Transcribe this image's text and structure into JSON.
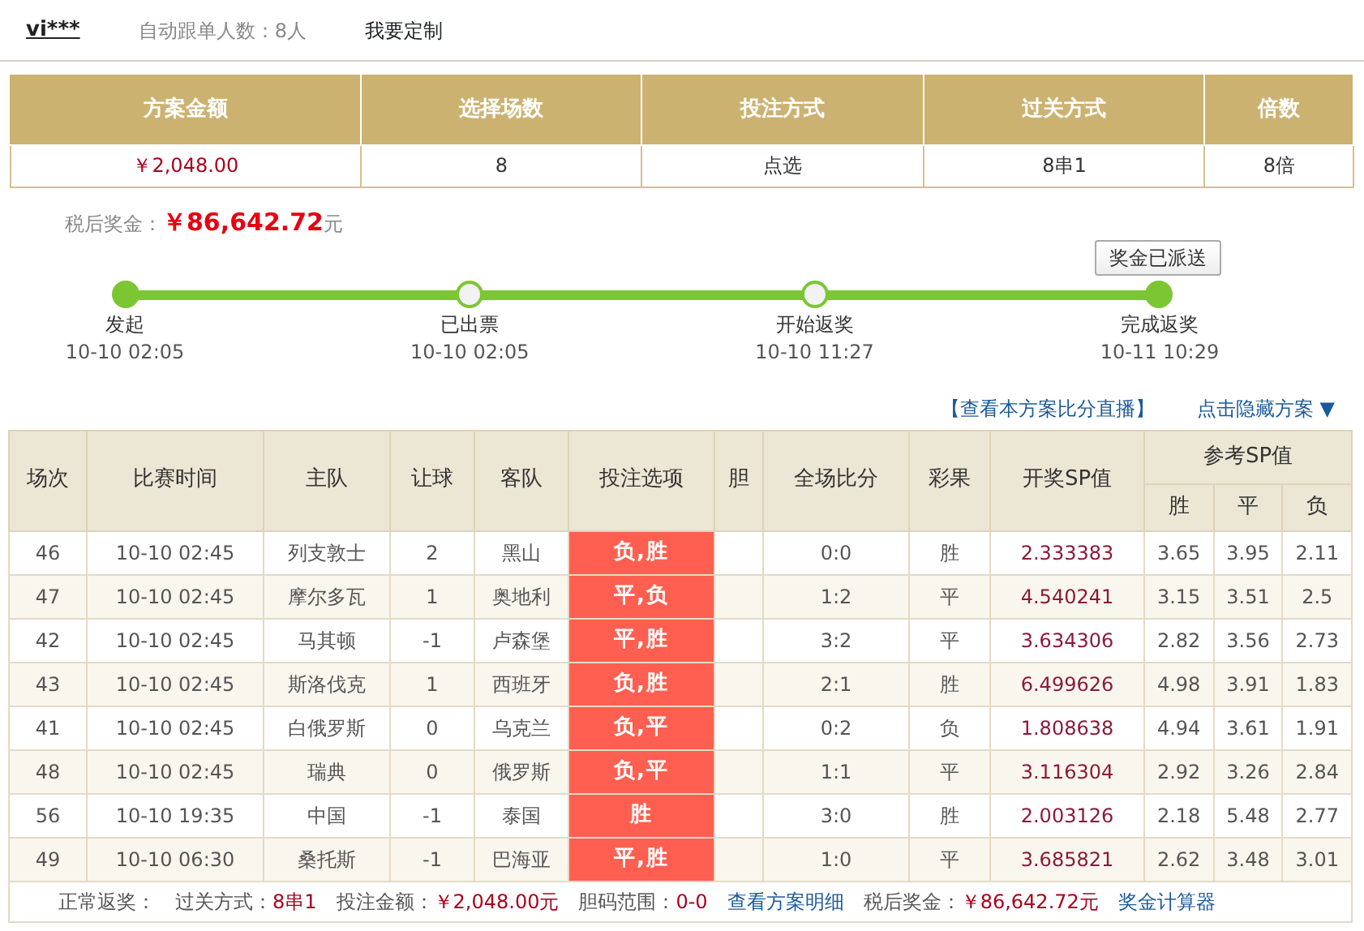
{
  "header": {
    "user": "vi***",
    "followers_label": "自动跟单人数：",
    "followers": "8人",
    "customize": "我要定制"
  },
  "summary": {
    "columns": [
      "方案金额",
      "选择场数",
      "投注方式",
      "过关方式",
      "倍数"
    ],
    "values": [
      "￥2,048.00",
      "8",
      "点选",
      "8串1",
      "8倍"
    ]
  },
  "prize": {
    "label": "税后奖金：",
    "amount": "￥86,642.72",
    "unit": "元"
  },
  "status_button": "奖金已派送",
  "timeline": [
    {
      "label": "发起",
      "time": "10-10 02:05",
      "filled": true
    },
    {
      "label": "已出票",
      "time": "10-10 02:05",
      "filled": false
    },
    {
      "label": "开始返奖",
      "time": "10-10 11:27",
      "filled": false
    },
    {
      "label": "完成返奖",
      "time": "10-11 10:29",
      "filled": true
    }
  ],
  "links": {
    "live": "【查看本方案比分直播】",
    "hide": "点击隐藏方案 ▼"
  },
  "table": {
    "columns": [
      "场次",
      "比赛时间",
      "主队",
      "让球",
      "客队",
      "投注选项",
      "胆",
      "全场比分",
      "彩果",
      "开奖SP值"
    ],
    "ref_group": "参考SP值",
    "ref_columns": [
      "胜",
      "平",
      "负"
    ],
    "rows": [
      {
        "no": "46",
        "time": "10-10 02:45",
        "home": "列支敦士",
        "handicap": "2",
        "away": "黑山",
        "bet": "负,胜",
        "score": "0:0",
        "result": "胜",
        "sp": "2.333383",
        "ref": [
          "3.65",
          "3.95",
          "2.11"
        ]
      },
      {
        "no": "47",
        "time": "10-10 02:45",
        "home": "摩尔多瓦",
        "handicap": "1",
        "away": "奥地利",
        "bet": "平,负",
        "score": "1:2",
        "result": "平",
        "sp": "4.540241",
        "ref": [
          "3.15",
          "3.51",
          "2.5"
        ]
      },
      {
        "no": "42",
        "time": "10-10 02:45",
        "home": "马其顿",
        "handicap": "-1",
        "away": "卢森堡",
        "bet": "平,胜",
        "score": "3:2",
        "result": "平",
        "sp": "3.634306",
        "ref": [
          "2.82",
          "3.56",
          "2.73"
        ]
      },
      {
        "no": "43",
        "time": "10-10 02:45",
        "home": "斯洛伐克",
        "handicap": "1",
        "away": "西班牙",
        "bet": "负,胜",
        "score": "2:1",
        "result": "胜",
        "sp": "6.499626",
        "ref": [
          "4.98",
          "3.91",
          "1.83"
        ]
      },
      {
        "no": "41",
        "time": "10-10 02:45",
        "home": "白俄罗斯",
        "handicap": "0",
        "away": "乌克兰",
        "bet": "负,平",
        "score": "0:2",
        "result": "负",
        "sp": "1.808638",
        "ref": [
          "4.94",
          "3.61",
          "1.91"
        ]
      },
      {
        "no": "48",
        "time": "10-10 02:45",
        "home": "瑞典",
        "handicap": "0",
        "away": "俄罗斯",
        "bet": "负,平",
        "score": "1:1",
        "result": "平",
        "sp": "3.116304",
        "ref": [
          "2.92",
          "3.26",
          "2.84"
        ]
      },
      {
        "no": "56",
        "time": "10-10 19:35",
        "home": "中国",
        "handicap": "-1",
        "away": "泰国",
        "bet": "胜",
        "score": "3:0",
        "result": "胜",
        "sp": "2.003126",
        "ref": [
          "2.18",
          "5.48",
          "2.77"
        ]
      },
      {
        "no": "49",
        "time": "10-10 06:30",
        "home": "桑托斯",
        "handicap": "-1",
        "away": "巴海亚",
        "bet": "平,胜",
        "score": "1:0",
        "result": "平",
        "sp": "3.685821",
        "ref": [
          "2.62",
          "3.48",
          "3.01"
        ]
      }
    ]
  },
  "footer": [
    {
      "kind": "label",
      "text": "正常返奖："
    },
    {
      "kind": "pair",
      "label": "过关方式：",
      "value": "8串1"
    },
    {
      "kind": "pair",
      "label": "投注金额：",
      "value": "￥2,048.00元"
    },
    {
      "kind": "pair",
      "label": "胆码范围：",
      "value": "0-0"
    },
    {
      "kind": "link",
      "text": "查看方案明细"
    },
    {
      "kind": "pair",
      "label": "税后奖金：",
      "value": "￥86,642.72元"
    },
    {
      "kind": "link",
      "text": "奖金计算器"
    }
  ]
}
